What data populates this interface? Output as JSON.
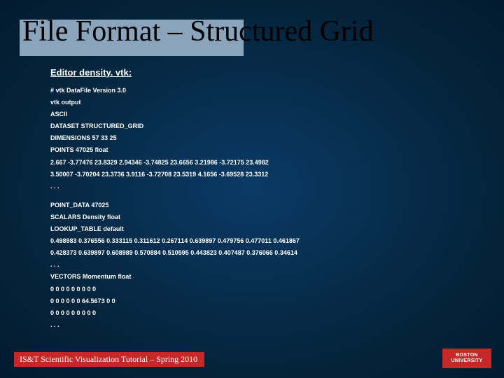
{
  "title": "File Format – Structured Grid",
  "editor_heading": "Editor density. vtk:",
  "lines_block1": [
    "# vtk DataFile Version 3.0",
    "vtk output",
    "ASCII",
    "DATASET STRUCTURED_GRID",
    "DIMENSIONS 57 33 25",
    "POINTS 47025 float",
    "2.667 -3.77476 23.8329 2.94346 -3.74825 23.6656 3.21986 -3.72175 23.4982",
    "3.50007 -3.70204 23.3736 3.9116 -3.72708 23.5319 4.1656 -3.69528 23.3312",
    ". . ."
  ],
  "lines_block2": [
    "POINT_DATA 47025",
    "SCALARS Density float",
    "LOOKUP_TABLE default",
    "0.498983 0.376556 0.333115 0.311612 0.267114 0.639897 0.479756 0.477011 0.461867",
    "0.428373 0.639897 0.608989 0.570884 0.510595 0.443823 0.407487 0.376066 0.34614",
    ". . .",
    "VECTORS Momentum float",
    "0 0 0 0 0 0 0 0 0",
    "0 0 0 0 0 0 64.5673 0 0",
    "0 0 0 0 0 0 0 0 0",
    ". . ."
  ],
  "footer": "IS&T Scientific Visualization Tutorial – Spring 2010",
  "logo": {
    "line1": "BOSTON",
    "line2": "UNIVERSITY"
  }
}
